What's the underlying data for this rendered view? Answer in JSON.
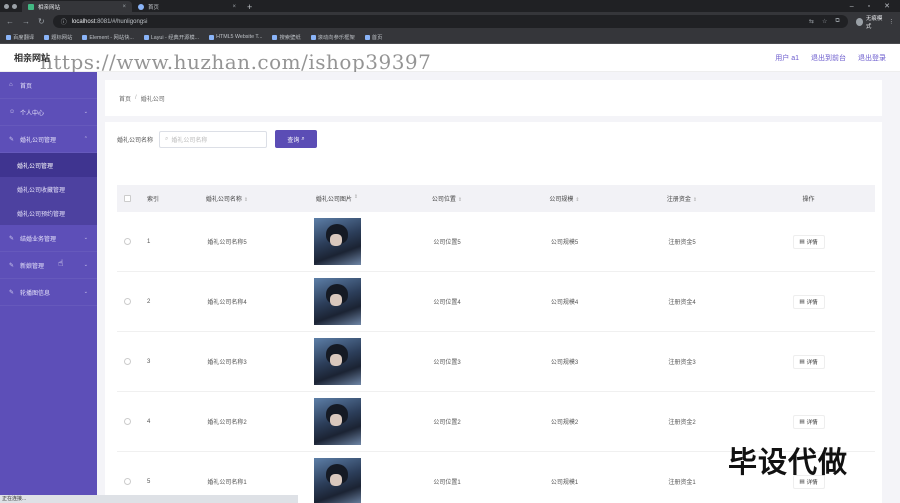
{
  "browser": {
    "tabs": [
      {
        "title": "相亲网站",
        "active": true
      },
      {
        "title": "首页",
        "active": false
      }
    ],
    "url_host": "localhost",
    "url_rest": ":8081/#/hunligongsi",
    "profile_label": "无痕模式",
    "bookmarks": [
      "百度翻译",
      "题标网站",
      "Element - 网站快...",
      "Layui - 经典开源模...",
      "HTML5 Website T...",
      "搜索壁纸",
      "滚动向参乐框架",
      "首页"
    ],
    "status_text": "正在连接..."
  },
  "header": {
    "logo": "相亲网站",
    "watermark": "https://www.huzhan.com/ishop39397",
    "user_label": "用户 a1",
    "back_label": "退出到前台",
    "logout_label": "退出登录"
  },
  "sidebar": {
    "home": "首页",
    "personal": "个人中心",
    "wedding_mgmt": "婚礼公司管理",
    "sub": [
      "婚礼公司管理",
      "婚礼公司收藏管理",
      "婚礼公司预约管理"
    ],
    "marriage": "结婚业务管理",
    "bride": "新娘管理",
    "carousel": "轮播图信息"
  },
  "breadcrumb": {
    "home": "首页",
    "sep": "/",
    "current": "婚礼公司"
  },
  "search": {
    "label": "婚礼公司名称",
    "placeholder": "婚礼公司名称",
    "button": "查询"
  },
  "table": {
    "headers": {
      "index": "索引",
      "name": "婚礼公司名称",
      "image": "婚礼公司图片",
      "position": "公司位置",
      "scale": "公司规模",
      "capital": "注册资金",
      "op": "操作"
    },
    "detail_label": "详情",
    "rows": [
      {
        "index": "1",
        "name": "婚礼公司名称5",
        "position": "公司位置5",
        "scale": "公司规模5",
        "capital": "注册资金5"
      },
      {
        "index": "2",
        "name": "婚礼公司名称4",
        "position": "公司位置4",
        "scale": "公司规模4",
        "capital": "注册资金4"
      },
      {
        "index": "3",
        "name": "婚礼公司名称3",
        "position": "公司位置3",
        "scale": "公司规模3",
        "capital": "注册资金3"
      },
      {
        "index": "4",
        "name": "婚礼公司名称2",
        "position": "公司位置2",
        "scale": "公司规模2",
        "capital": "注册资金2"
      },
      {
        "index": "5",
        "name": "婚礼公司名称1",
        "position": "公司位置1",
        "scale": "公司规模1",
        "capital": "注册资金1"
      }
    ]
  },
  "overlay_text": "毕设代做",
  "colors": {
    "sidebar": "#5d4fb8",
    "accent": "#5b4db5"
  }
}
